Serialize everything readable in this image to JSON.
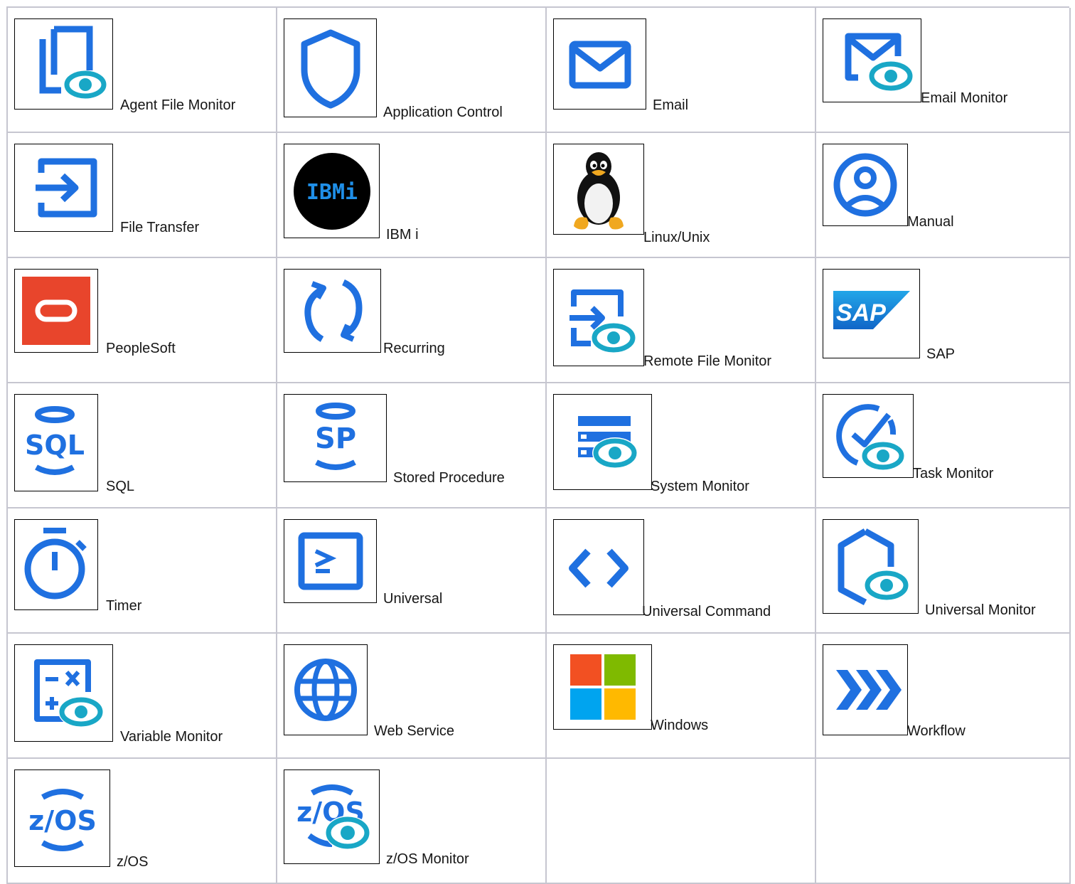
{
  "colors": {
    "icon_blue": "#1f70e0",
    "eye_teal": "#19a7c6",
    "grid_line": "#c6c6d0",
    "oracle_red": "#e8452c"
  },
  "tasks": [
    {
      "label": "Agent File Monitor",
      "icon": "agent-file-monitor-icon"
    },
    {
      "label": "Application Control",
      "icon": "application-control-icon"
    },
    {
      "label": "Email",
      "icon": "email-icon"
    },
    {
      "label": "Email Monitor",
      "icon": "email-monitor-icon"
    },
    {
      "label": "File Transfer",
      "icon": "file-transfer-icon"
    },
    {
      "label": "IBM i",
      "icon": "ibm-i-icon",
      "icon_text": "IBMi"
    },
    {
      "label": "Linux/Unix",
      "icon": "linux-tux-icon"
    },
    {
      "label": "Manual",
      "icon": "manual-user-icon"
    },
    {
      "label": "PeopleSoft",
      "icon": "peoplesoft-oracle-icon"
    },
    {
      "label": "Recurring",
      "icon": "recurring-icon"
    },
    {
      "label": "Remote File Monitor",
      "icon": "remote-file-monitor-icon"
    },
    {
      "label": "SAP",
      "icon": "sap-logo-icon",
      "icon_text": "SAP"
    },
    {
      "label": "SQL",
      "icon": "sql-database-icon",
      "icon_text": "SQL"
    },
    {
      "label": "Stored Procedure",
      "icon": "stored-procedure-icon",
      "icon_text": "SP"
    },
    {
      "label": "System Monitor",
      "icon": "system-monitor-icon"
    },
    {
      "label": "Task Monitor",
      "icon": "task-monitor-icon"
    },
    {
      "label": "Timer",
      "icon": "timer-stopwatch-icon"
    },
    {
      "label": "Universal",
      "icon": "universal-terminal-icon"
    },
    {
      "label": "Universal Command",
      "icon": "universal-command-code-icon"
    },
    {
      "label": "Universal Monitor",
      "icon": "universal-monitor-icon"
    },
    {
      "label": "Variable Monitor",
      "icon": "variable-monitor-icon"
    },
    {
      "label": "Web Service",
      "icon": "web-service-globe-icon"
    },
    {
      "label": "Windows",
      "icon": "windows-logo-icon"
    },
    {
      "label": "Workflow",
      "icon": "workflow-chevrons-icon"
    },
    {
      "label": "z/OS",
      "icon": "zos-icon",
      "icon_text": "z/OS"
    },
    {
      "label": "z/OS Monitor",
      "icon": "zos-monitor-icon",
      "icon_text": "z/OS"
    }
  ]
}
